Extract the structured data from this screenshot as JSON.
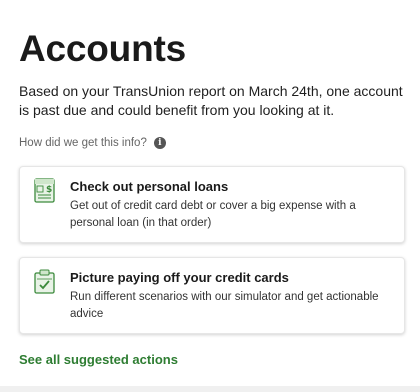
{
  "page": {
    "title": "Accounts",
    "intro": "Based on your TransUnion report on March 24th, one account is past due and could benefit from you looking at it.",
    "info_text": "How did we get this info?",
    "info_icon": "info-icon",
    "info_glyph": "i"
  },
  "cards": [
    {
      "icon": "loan-document-icon",
      "title": "Check out personal loans",
      "description": "Get out of credit card debt or cover a big expense with a personal loan (in that order)"
    },
    {
      "icon": "checklist-clipboard-icon",
      "title": "Picture paying off your credit cards",
      "description": "Run different scenarios with our simulator and get actionable advice"
    }
  ],
  "footer": {
    "see_all_label": "See all suggested actions"
  },
  "colors": {
    "accent_green": "#2e7d32",
    "icon_green": "#3c8a3c",
    "background": "#f0f0f0"
  }
}
